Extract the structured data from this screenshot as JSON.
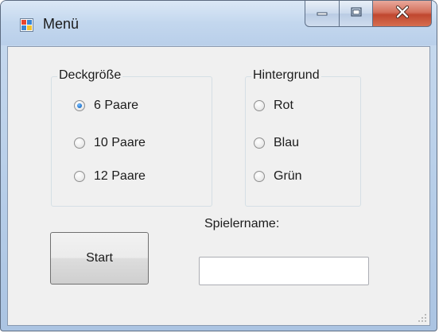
{
  "window": {
    "title": "Menü",
    "icon": "form-icon",
    "caption_buttons": [
      "minimize-icon",
      "maximize-icon",
      "close-icon"
    ]
  },
  "deck_group": {
    "title": "Deckgröße",
    "options": [
      {
        "label": "6 Paare",
        "checked": true
      },
      {
        "label": "10 Paare",
        "checked": false
      },
      {
        "label": "12 Paare",
        "checked": false
      }
    ]
  },
  "background_group": {
    "title": "Hintergrund",
    "options": [
      {
        "label": "Rot",
        "checked": false
      },
      {
        "label": "Blau",
        "checked": false
      },
      {
        "label": "Grün",
        "checked": false
      }
    ]
  },
  "start_button": {
    "label": "Start"
  },
  "player_name": {
    "label": "Spielername:",
    "value": ""
  },
  "colors": {
    "accent": "#2a7fd6",
    "close_button": "#c0472f",
    "form_background": "#f0f0f0"
  }
}
